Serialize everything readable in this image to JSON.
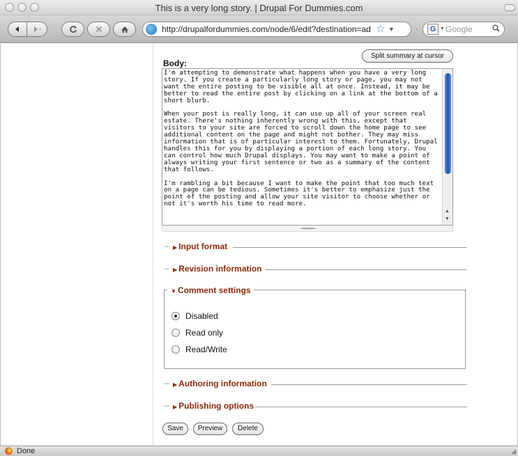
{
  "window": {
    "title": "This is a very long story. | Drupal For Dummies.com"
  },
  "toolbar": {
    "url": "http://drupalfordummies.com/node/6/edit?destination=ad",
    "search_placeholder": "Google",
    "search_engine_letter": "G"
  },
  "form": {
    "body_label": "Body:",
    "split_button": "Split summary at cursor",
    "body_text": "I'm attempting to demonstrate what happens when you have a very long story. If you create a particularly long story or page, you may not want the entire posting to be visible all at once. Instead, it may be better to read the entire post by clicking on a link at the bottom of a short blurb.\n\nWhen your post is really long, it can use up all of your screen real estate. There's nothing inherently wrong with this, except that visitors to your site are forced to scroll down the home page to see additional content on the page and might not bother. They may miss information that is of particular interest to them. Fortunately, Drupal handles this for you by displaying a portion of each long story. You can control how much Drupal displays. You may want to make a point of always writing your first sentence or two as a summary of the content that follows.\n\nI'm rambling a bit because I want to make the point that too much text on a page can be tedious. Sometimes it's better to emphasize just the point of the posting and allow your site visitor to choose whether or not it's worth his time to read more.",
    "sections": {
      "input_format": "Input format",
      "revision_information": "Revision information",
      "comment_settings": "Comment settings",
      "authoring_information": "Authoring information",
      "publishing_options": "Publishing options"
    },
    "comment_options": [
      {
        "label": "Disabled",
        "checked": true
      },
      {
        "label": "Read only",
        "checked": false
      },
      {
        "label": "Read/Write",
        "checked": false
      }
    ],
    "buttons": {
      "save": "Save",
      "preview": "Preview",
      "delete": "Delete"
    }
  },
  "status": {
    "text": "Done"
  }
}
